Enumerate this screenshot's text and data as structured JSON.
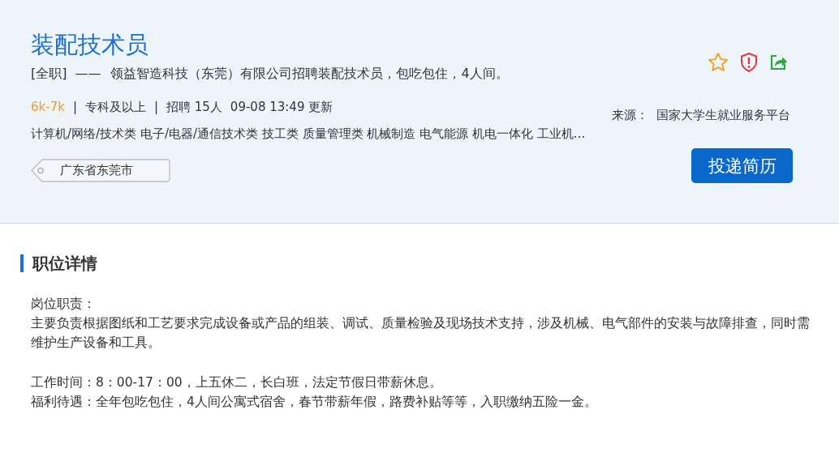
{
  "job": {
    "title": "装配技术员",
    "type": "[全职]",
    "dash": "——",
    "summary": "领益智造科技（东莞）有限公司招聘装配技术员，包吃包住，4人间。",
    "meta": [
      {
        "kind": "salary",
        "text": "6k-7k"
      },
      {
        "kind": "sep",
        "text": "|"
      },
      {
        "kind": "plain",
        "text": "专科及以上"
      },
      {
        "kind": "sep",
        "text": "|"
      },
      {
        "kind": "plain",
        "text": "招聘 15人"
      },
      {
        "kind": "plain",
        "text": "09-08 13:49 更新"
      }
    ],
    "categories": "计算机/网络/技术类 电子/电器/通信技术类 技工类 质量管理类 机械制造 电气能源 机电一体化 工业机…",
    "location": "广东省东莞市",
    "source_label": "来源：",
    "source": "国家大学生就业服务平台",
    "apply_button": "投递简历"
  },
  "details": {
    "heading": "职位详情",
    "blocks": [
      {
        "lines": [
          "岗位职责：",
          "主要负责根据图纸和工艺要求完成设备或产品的组装、调试、质量检验及现场技术支持，涉及机械、电气部件的安装与故障排查，同时需维护生产设备和工具。"
        ]
      },
      {
        "lines": [
          "工作时间：8：00-17：00，上五休二，长白班，法定节假日带薪休息。",
          "福利待遇：全年包吃包住，4人间公寓式宿舍，春节带薪年假，路费补贴等等，入职缴纳五险一金。"
        ]
      }
    ]
  }
}
